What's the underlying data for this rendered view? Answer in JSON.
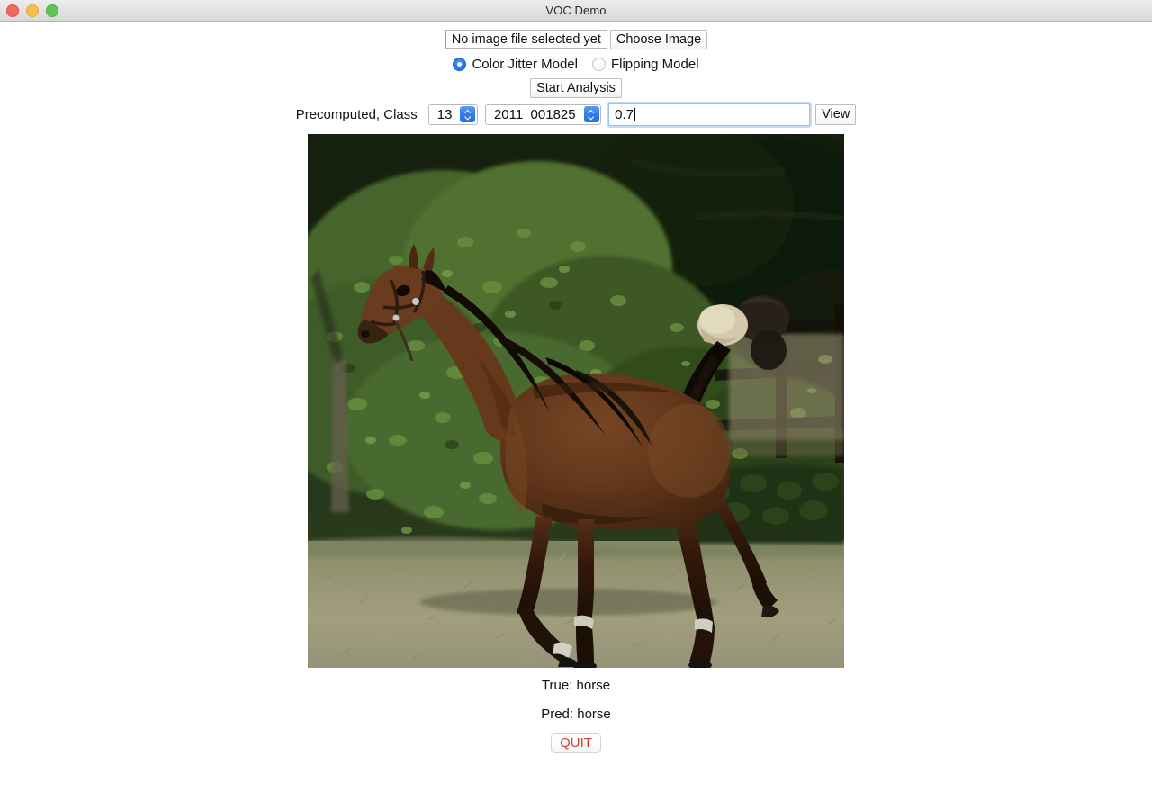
{
  "window": {
    "title": "VOC Demo",
    "controls": {
      "close": "close-button",
      "minimize": "minimize-button",
      "maximize": "maximize-button"
    }
  },
  "toolbar": {
    "file_status": "No image file selected yet",
    "choose_image_label": "Choose Image",
    "start_analysis_label": "Start Analysis",
    "models": [
      {
        "label": "Color Jitter Model",
        "selected": true
      },
      {
        "label": "Flipping Model",
        "selected": false
      }
    ],
    "precomputed_label": "Precomputed, Class",
    "class_value": "13",
    "image_id_value": "2011_001825",
    "threshold_value": "0.7",
    "threshold_placeholder": "",
    "view_label": "View"
  },
  "image": {
    "alt": "horse-photo",
    "subject": "bay horse trotting in a paddock",
    "background": "green foliage and dark wooden fence",
    "ground": "dry grass field"
  },
  "results": {
    "true_label": "True: horse",
    "pred_label": "Pred: horse",
    "quit_label": "QUIT"
  },
  "colors": {
    "accent_blue": "#2f7de9",
    "quit_red": "#cf3f34",
    "titlebar": "#e4e4e4",
    "focus_ring": "#6ea8e9"
  }
}
